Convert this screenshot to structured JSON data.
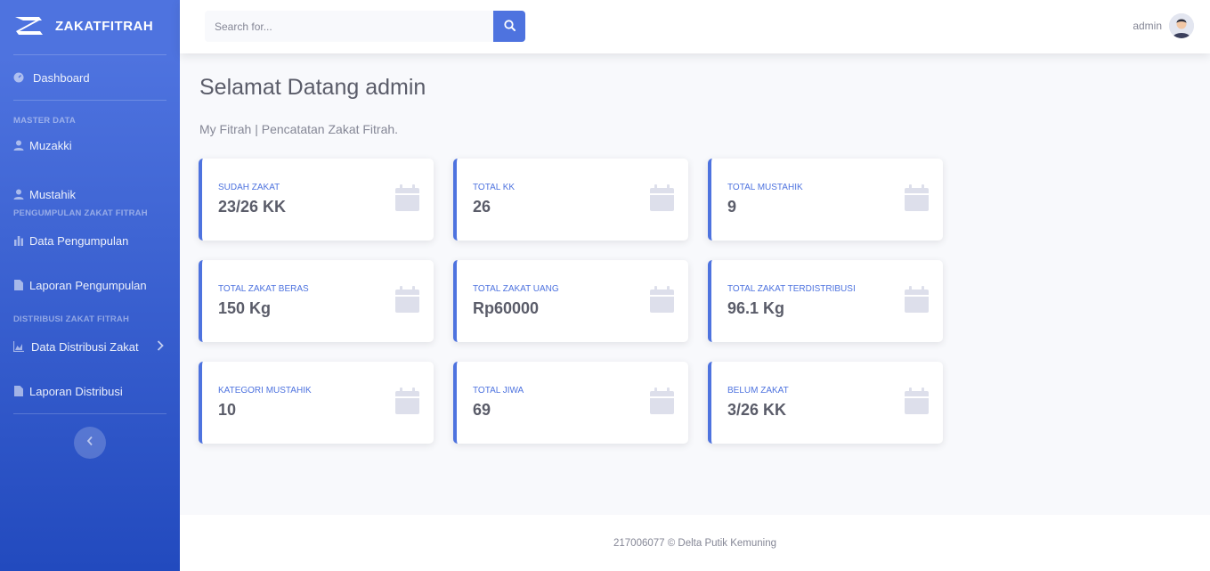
{
  "brand": {
    "name": "ZAKATFITRAH",
    "logo_icon": "laugh-wink-icon"
  },
  "sidebar": {
    "dashboard": {
      "label": "Dashboard",
      "icon": "tachometer-icon"
    },
    "heading_master": "MASTER DATA",
    "muzakki": {
      "label": "Muzakki",
      "icon": "user-icon"
    },
    "mustahik": {
      "label": "Mustahik",
      "icon": "user-icon"
    },
    "heading_pengumpulan": "PENGUMPULAN ZAKAT FITRAH",
    "data_pengumpulan": {
      "label": "Data Pengumpulan",
      "icon": "chart-bar-icon"
    },
    "laporan_pengumpulan": {
      "label": "Laporan Pengumpulan",
      "icon": "file-icon"
    },
    "heading_distribusi": "DISTRIBUSI ZAKAT FITRAH",
    "data_distribusi": {
      "label": "Data Distribusi Zakat",
      "icon": "chart-area-icon"
    },
    "laporan_distribusi": {
      "label": "Laporan Distribusi",
      "icon": "file-icon"
    }
  },
  "topbar": {
    "search_placeholder": "Search for...",
    "user_name": "admin"
  },
  "main": {
    "title": "Selamat Datang admin",
    "subtitle": "My Fitrah | Pencatatan Zakat Fitrah."
  },
  "cards": [
    {
      "label": "SUDAH ZAKAT",
      "value": "23/26 KK",
      "icon": "calendar-icon"
    },
    {
      "label": "TOTAL KK",
      "value": "26",
      "icon": "calendar-icon"
    },
    {
      "label": "TOTAL MUSTAHIK",
      "value": "9",
      "icon": "calendar-icon"
    },
    {
      "label": "TOTAL ZAKAT BERAS",
      "value": "150 Kg",
      "icon": "calendar-icon"
    },
    {
      "label": "TOTAL ZAKAT UANG",
      "value": "Rp60000",
      "icon": "calendar-icon"
    },
    {
      "label": "TOTAL ZAKAT TERDISTRIBUSI",
      "value": "96.1 Kg",
      "icon": "calendar-icon"
    },
    {
      "label": "KATEGORI MUSTAHIK",
      "value": "10",
      "icon": "calendar-icon"
    },
    {
      "label": "TOTAL JIWA",
      "value": "69",
      "icon": "calendar-icon"
    },
    {
      "label": "BELUM ZAKAT",
      "value": "3/26 KK",
      "icon": "calendar-icon"
    }
  ],
  "footer": {
    "text": "217006077 © Delta Putik Kemuning"
  },
  "colors": {
    "primary": "#4e73df",
    "primary_dark": "#224abe",
    "text": "#5a5c69",
    "muted": "#858796"
  }
}
